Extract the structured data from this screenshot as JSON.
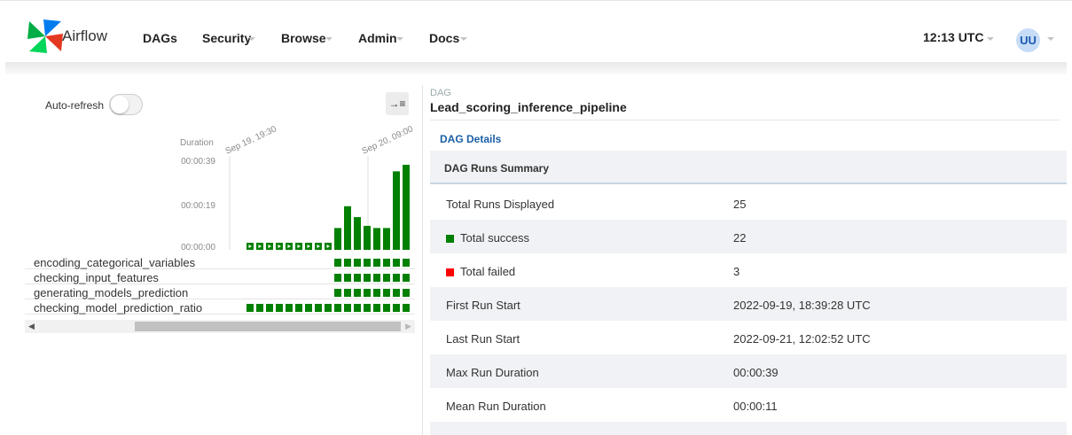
{
  "app": {
    "brand": "Airflow"
  },
  "nav": {
    "items": [
      {
        "label": "DAGs",
        "has_caret": false
      },
      {
        "label": "Security",
        "has_caret": true
      },
      {
        "label": "Browse",
        "has_caret": true
      },
      {
        "label": "Admin",
        "has_caret": true
      },
      {
        "label": "Docs",
        "has_caret": true
      }
    ],
    "time": "12:13 UTC",
    "user_initials": "UU"
  },
  "grid": {
    "auto_refresh_label": "Auto-refresh",
    "auto_refresh_on": false,
    "expand_icon": "→≡",
    "duration_label": "Duration",
    "duration_ticks": [
      "00:00:39",
      "00:00:19",
      "00:00:00"
    ],
    "date_labels": [
      "Sep 19, 19:30",
      "Sep 20, 09:00"
    ],
    "run_durations_seconds": [
      2,
      2,
      2,
      2,
      2,
      2,
      2,
      2,
      2,
      10,
      20,
      15,
      11,
      10,
      10,
      36,
      39
    ],
    "tasks": [
      {
        "label": "encoding_categorical_variables",
        "runs": 8
      },
      {
        "label": "checking_input_features",
        "runs": 8
      },
      {
        "label": "generating_models_prediction",
        "runs": 8
      },
      {
        "label": "checking_model_prediction_ratio",
        "runs": 17
      }
    ],
    "colors": {
      "success": "#008000",
      "failed": "#ff0000"
    }
  },
  "dag": {
    "kicker": "DAG",
    "title": "Lead_scoring_inference_pipeline",
    "details_link": "DAG Details",
    "summary_header": "DAG Runs Summary",
    "rows": [
      {
        "label": "Total Runs Displayed",
        "value": "25",
        "swatch": ""
      },
      {
        "label": "Total success",
        "value": "22",
        "swatch": "#008000"
      },
      {
        "label": "Total failed",
        "value": "3",
        "swatch": "#ff0000"
      },
      {
        "label": "First Run Start",
        "value": "2022-09-19, 18:39:28 UTC",
        "swatch": ""
      },
      {
        "label": "Last Run Start",
        "value": "2022-09-21, 12:02:52 UTC",
        "swatch": ""
      },
      {
        "label": "Max Run Duration",
        "value": "00:00:39",
        "swatch": ""
      },
      {
        "label": "Mean Run Duration",
        "value": "00:00:11",
        "swatch": ""
      }
    ]
  }
}
